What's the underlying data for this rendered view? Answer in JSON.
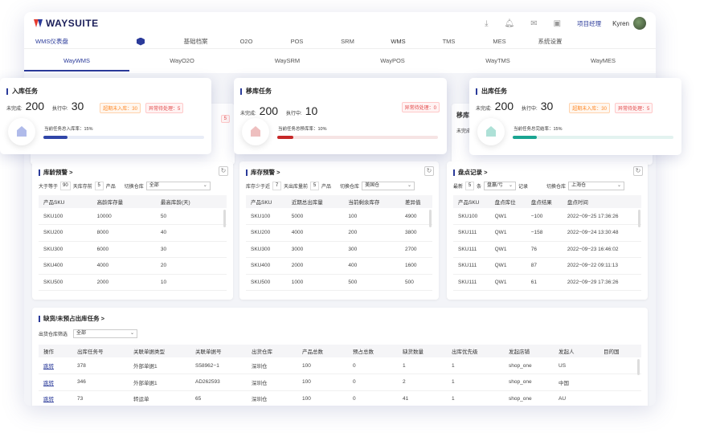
{
  "app": {
    "logo": "WAYSUITE",
    "project_link": "项目经理",
    "user": "Kyren"
  },
  "menu": {
    "title": "WMS仪表盘",
    "items": [
      "基础档案",
      "O2O",
      "POS",
      "SRM",
      "WMS",
      "TMS",
      "MES",
      "系统设置"
    ]
  },
  "subtabs": [
    "WayWMS",
    "WayO2O",
    "WaySRM",
    "WayPOS",
    "WayTMS",
    "WayMES"
  ],
  "cards": {
    "inbound": {
      "title": "入库任务",
      "undone_label": "未完成:",
      "undone": "200",
      "running_label": "执行中:",
      "running": "30",
      "tag1": "超期未入库：30",
      "tag2": "异常待处理：5",
      "rate": "当前任务总入库率：15%",
      "progress": 0.15,
      "color": "#2f45a8",
      "track": "#e9edf7"
    },
    "transfer": {
      "title": "移库任务",
      "undone_label": "未完成:",
      "undone": "200",
      "running_label": "执行中:",
      "running": "10",
      "tag2": "异常待处理：0",
      "rate": "当前任务总移库率：10%",
      "progress": 0.1,
      "color": "#c62828",
      "track": "#f6e4e4"
    },
    "outbound": {
      "title": "出库任务",
      "undone_label": "未完成:",
      "undone": "200",
      "running_label": "执行中:",
      "running": "30",
      "tag1": "超期未入库：30",
      "tag2": "异常待处理：5",
      "rate": "当前任务总完结率：15%",
      "progress": 0.15,
      "color": "#1aa592",
      "track": "#e3f3f0"
    },
    "peek_left": {
      "tag": "5"
    },
    "peek_right": {
      "title": "移库",
      "undone_label": "未完成"
    }
  },
  "age": {
    "title": "库龄预警 >",
    "f1": "大于等于",
    "v1": "90",
    "f2": "天库存前",
    "v2": "5",
    "f3": "产品",
    "f4": "切换仓库",
    "wh": "全部",
    "headers": [
      "产品SKU",
      "高龄库存量",
      "最高库龄(天)"
    ],
    "rows": [
      [
        "SKU100",
        "10000",
        "50"
      ],
      [
        "SKU200",
        "8000",
        "40"
      ],
      [
        "SKU300",
        "6000",
        "30"
      ],
      [
        "SKU400",
        "4000",
        "20"
      ],
      [
        "SKU500",
        "2000",
        "10"
      ]
    ]
  },
  "stock": {
    "title": "库存预警 >",
    "f1": "库存少于近",
    "v1": "7",
    "f2": "天出库量前",
    "v2": "5",
    "f3": "产品",
    "f4": "切换仓库",
    "wh": "美国仓",
    "headers": [
      "产品SKU",
      "近期总出库量",
      "当前剩余库存",
      "差异值"
    ],
    "rows": [
      [
        "SKU100",
        "5000",
        "100",
        "4900"
      ],
      [
        "SKU200",
        "4000",
        "200",
        "3800"
      ],
      [
        "SKU300",
        "3000",
        "300",
        "2700"
      ],
      [
        "SKU400",
        "2000",
        "400",
        "1600"
      ],
      [
        "SKU500",
        "1000",
        "500",
        "500"
      ]
    ]
  },
  "count": {
    "title": "盘点记录 >",
    "f1": "最新",
    "v1": "5",
    "f2": "条",
    "sel1": "盘赢/亏",
    "f3": "记录",
    "f4": "切换仓库",
    "wh": "上海仓",
    "headers": [
      "产品SKU",
      "盘点库位",
      "盘点结果",
      "盘点时间"
    ],
    "rows": [
      [
        "SKU100",
        "QW1",
        "−100",
        "2022−09−25 17:36:26"
      ],
      [
        "SKU111",
        "QW1",
        "−158",
        "2022−09−24 13:30:48"
      ],
      [
        "SKU111",
        "QW1",
        "76",
        "2022−09−23 16:46:02"
      ],
      [
        "SKU111",
        "QW1",
        "87",
        "2022−09−22 09:11:13"
      ],
      [
        "SKU111",
        "QW1",
        "61",
        "2022−09−29 17:36:26"
      ]
    ]
  },
  "shortage": {
    "title": "缺货/未预占出库任务 >",
    "filter": "出货仓库筛选",
    "wh": "全部",
    "headers": [
      "操作",
      "出库任务号",
      "关联单据类型",
      "关联单据号",
      "出货仓库",
      "产品总数",
      "预占总数",
      "缺货数量",
      "出库优先级",
      "发起店铺",
      "发起人",
      "目的国"
    ],
    "rows": [
      [
        "跳转",
        "378",
        "外部单据1",
        "S58962−1",
        "深圳仓",
        "100",
        "0",
        "1",
        "1",
        "shop_one",
        "US",
        ""
      ],
      [
        "跳转",
        "346",
        "外部单据1",
        "AD262593",
        "深圳仓",
        "100",
        "0",
        "2",
        "1",
        "shop_one",
        "中国",
        ""
      ],
      [
        "跳转",
        "73",
        "转运单",
        "65",
        "深圳仓",
        "100",
        "0",
        "41",
        "1",
        "shop_one",
        "AU",
        ""
      ]
    ]
  }
}
